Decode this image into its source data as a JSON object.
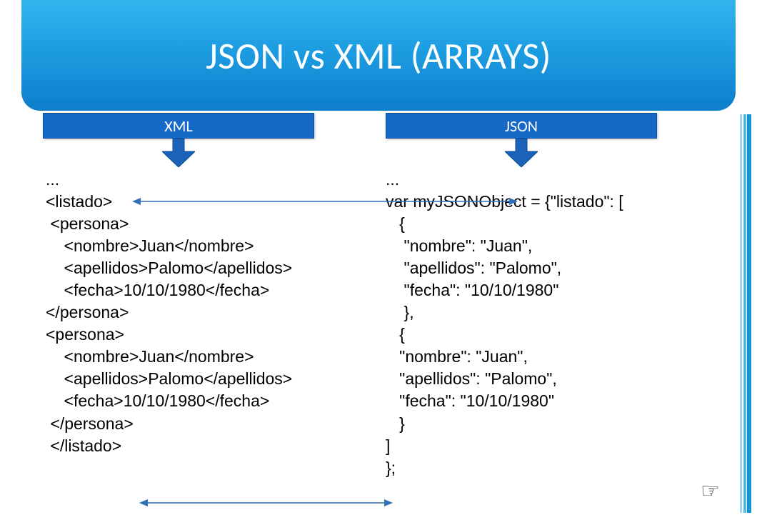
{
  "title": "JSON vs XML (ARRAYS)",
  "columns": {
    "xml_label": "XML",
    "json_label": "JSON"
  },
  "xml_code": "...\n<listado>\n <persona>\n    <nombre>Juan</nombre>\n    <apellidos>Palomo</apellidos>\n    <fecha>10/10/1980</fecha>\n</persona>\n<persona>\n    <nombre>Juan</nombre>\n    <apellidos>Palomo</apellidos>\n    <fecha>10/10/1980</fecha>\n </persona>\n </listado>",
  "json_code": "...\nvar myJSONObject = {\"listado\": [\n   {\n    \"nombre\": \"Juan\",\n    \"apellidos\": \"Palomo\",\n    \"fecha\": \"10/10/1980\"\n    },\n   {\n   \"nombre\": \"Juan\",\n   \"apellidos\": \"Palomo\",\n   \"fecha\": \"10/10/1980\"\n   }\n]\n};",
  "hand_glyph": "☞",
  "colors": {
    "header_blue": "#1769c7",
    "band_top": "#33b4ee",
    "band_bottom": "#0d7ecb",
    "arrow_line": "#2e6fb7"
  }
}
